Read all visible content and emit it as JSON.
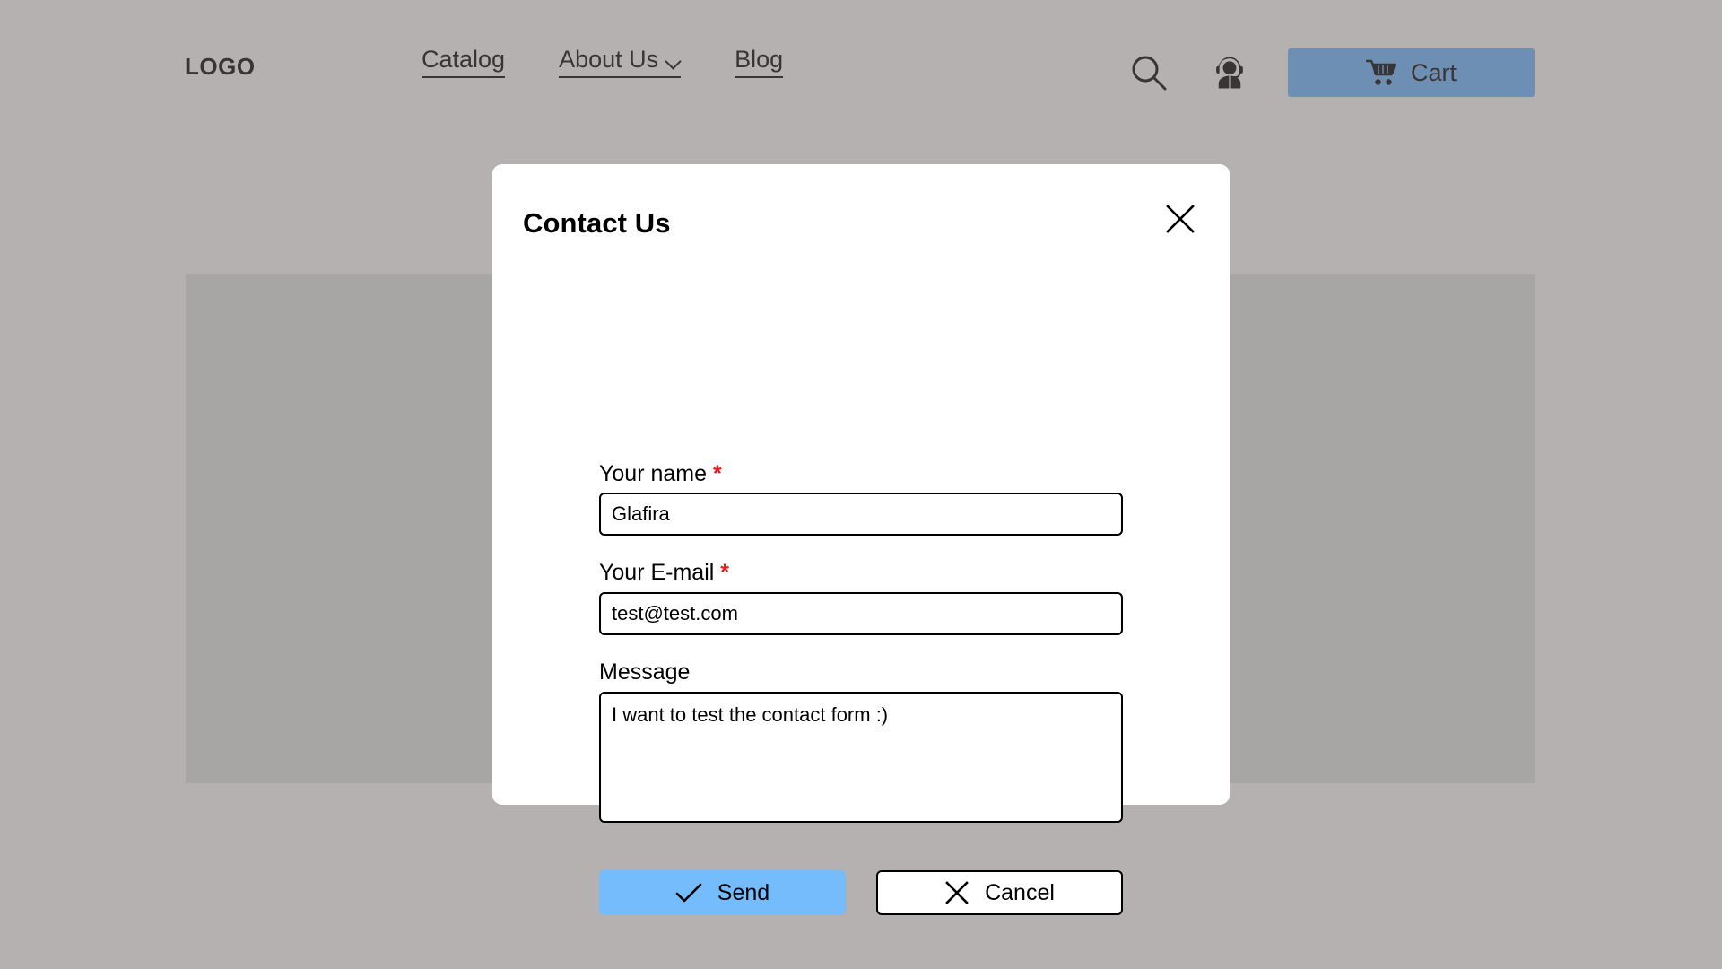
{
  "header": {
    "logo": "LOGO",
    "nav": [
      {
        "label": "Catalog",
        "has_dropdown": false,
        "icon": ""
      },
      {
        "label": "About Us",
        "has_dropdown": true,
        "icon": "chevron-down-icon"
      },
      {
        "label": "Blog",
        "has_dropdown": false,
        "icon": ""
      }
    ],
    "search_icon": "search-icon",
    "support_icon": "support-agent-icon",
    "cart": {
      "label": "Cart",
      "icon": "shopping-cart-icon",
      "color": "#6e8fb4"
    }
  },
  "modal": {
    "title": "Contact Us",
    "close_icon": "close-icon",
    "fields": [
      {
        "label": "Your name",
        "required": true,
        "required_mark": "*",
        "value": "Glafira",
        "placeholder": "",
        "type": "text"
      },
      {
        "label": "Your E-mail",
        "required": true,
        "required_mark": "*",
        "value": "test@test.com",
        "placeholder": "",
        "type": "text"
      },
      {
        "label": "Message",
        "required": false,
        "required_mark": "",
        "value": "I want to test the contact form :)",
        "placeholder": "",
        "type": "textarea"
      }
    ],
    "actions": [
      {
        "label": "Send",
        "icon": "check-icon",
        "style": "primary"
      },
      {
        "label": "Cancel",
        "icon": "x-icon",
        "style": "secondary"
      }
    ]
  },
  "colors": {
    "page_background": "#b4b1b0",
    "content_block": "#a8a5a5",
    "modal_background": "#ffffff",
    "send_button": "#74bcfc",
    "cart_button": "#6e8fb4",
    "required_asterisk": "#e81b23",
    "text": "#000000"
  }
}
